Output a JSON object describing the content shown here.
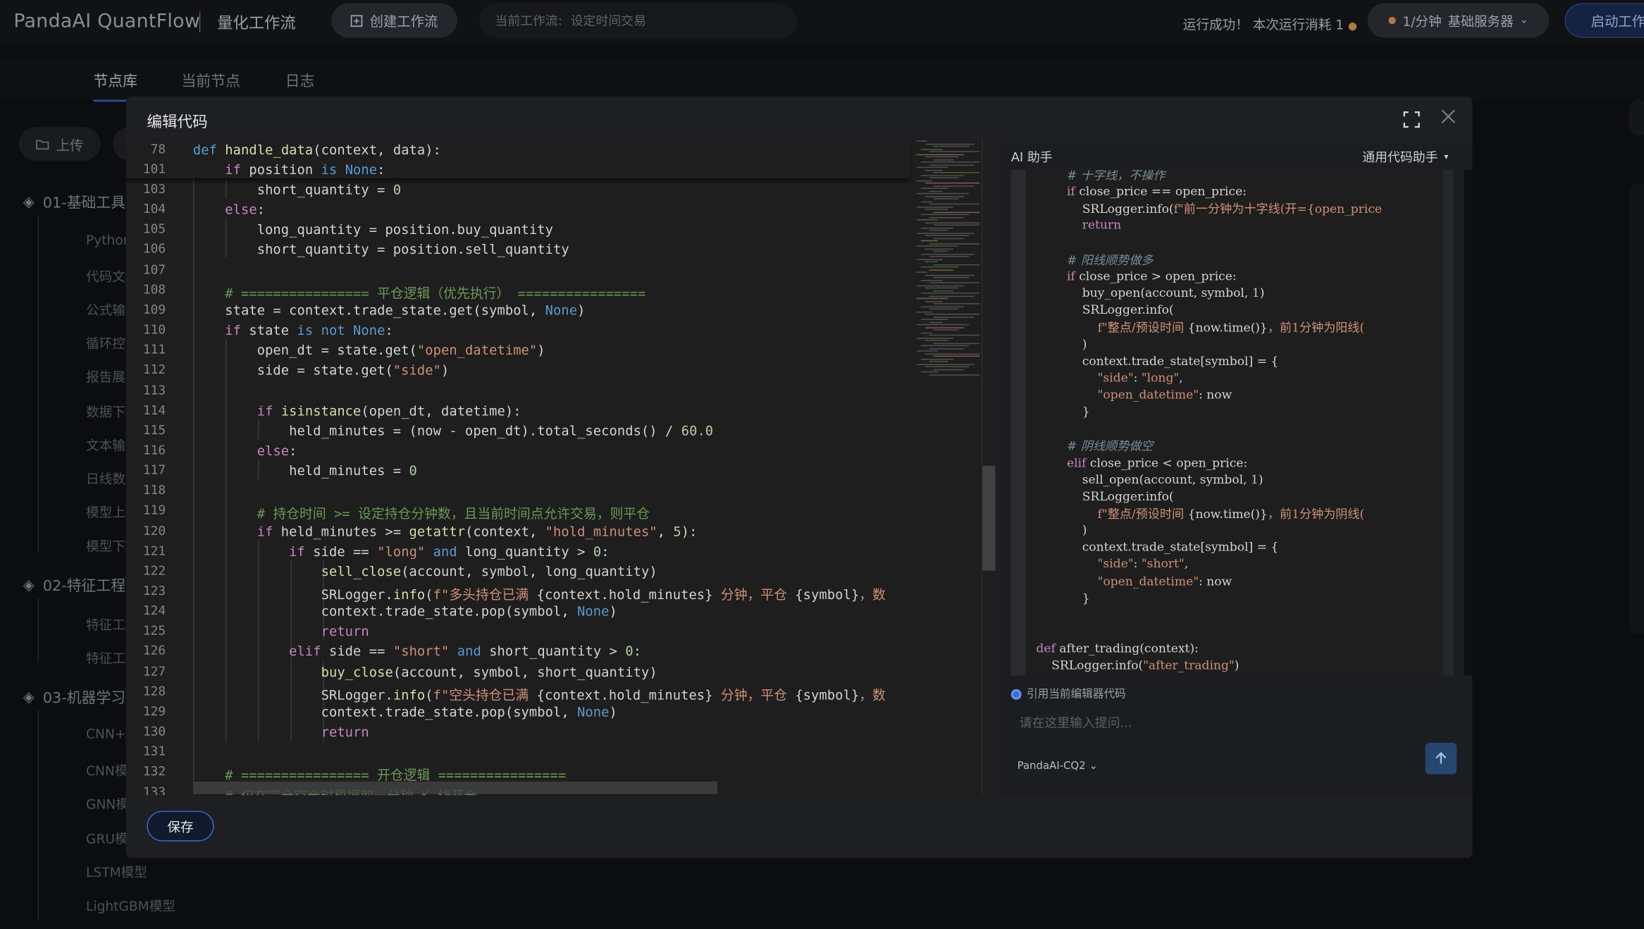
{
  "topbar": {
    "logo": "PandaAI QuantFlow",
    "subtitle": "量化工作流",
    "create_button": "创建工作流",
    "flow_label": "当前工作流:",
    "flow_name": "设定时间交易",
    "run_status": "运行成功！ 本次运行消耗 1",
    "server_rate": "1/分钟",
    "server_name": "基础服务器",
    "start_button": "启动工作"
  },
  "left_panel": {
    "tabs": [
      "节点库",
      "当前节点",
      "日志"
    ],
    "upload_button": "上传",
    "categories": [
      "01-基础工具",
      "02-特征工程",
      "03-机器学习"
    ],
    "items_group1": [
      "Python",
      "代码文",
      "公式输",
      "循环控",
      "报告展",
      "数据下",
      "文本输",
      "日线数",
      "模型上",
      "模型下"
    ],
    "items_group2": [
      "特征工",
      "特征工"
    ],
    "items_group3": [
      "CNN+T",
      "CNN模",
      "GNN模",
      "GRU模",
      "LSTM模型",
      "LightGBM模型"
    ]
  },
  "modal": {
    "title": "编辑代码",
    "save_button": "保存"
  },
  "editor": {
    "sticky": [
      {
        "n": "78",
        "html": "<span class=\"kw\">def</span> <span class=\"fn\">handle_data</span>(context, data):"
      },
      {
        "n": "101",
        "html": "    <span class=\"kw2\">if</span> position <span class=\"kw\">is</span> <span class=\"kw\">None</span>:"
      }
    ],
    "lines": [
      {
        "n": "103",
        "html": "        short_quantity = <span class=\"nm\">0</span>"
      },
      {
        "n": "104",
        "html": "    <span class=\"kw2\">else</span>:"
      },
      {
        "n": "105",
        "html": "        long_quantity = position.buy_quantity"
      },
      {
        "n": "106",
        "html": "        short_quantity = position.sell_quantity"
      },
      {
        "n": "107",
        "html": ""
      },
      {
        "n": "108",
        "html": "    <span class=\"cm\"># ================ 平仓逻辑（优先执行） ================</span>"
      },
      {
        "n": "109",
        "html": "    state = context.trade_state.get(symbol, <span class=\"kw\">None</span>)"
      },
      {
        "n": "110",
        "html": "    <span class=\"kw2\">if</span> state <span class=\"kw\">is not</span> <span class=\"kw\">None</span>:"
      },
      {
        "n": "111",
        "html": "        open_dt = state.get(<span class=\"st\">\"open_datetime\"</span>)"
      },
      {
        "n": "112",
        "html": "        side = state.get(<span class=\"st\">\"side\"</span>)"
      },
      {
        "n": "113",
        "html": ""
      },
      {
        "n": "114",
        "html": "        <span class=\"kw2\">if</span> <span class=\"fn\">isinstance</span>(open_dt, datetime):"
      },
      {
        "n": "115",
        "html": "            held_minutes = (now - open_dt).total_seconds() / <span class=\"nm\">60.0</span>"
      },
      {
        "n": "116",
        "html": "        <span class=\"kw2\">else</span>:"
      },
      {
        "n": "117",
        "html": "            held_minutes = <span class=\"nm\">0</span>"
      },
      {
        "n": "118",
        "html": ""
      },
      {
        "n": "119",
        "html": "        <span class=\"cm\"># 持仓时间 >= 设定持仓分钟数，且当前时间点允许交易，则平仓</span>"
      },
      {
        "n": "120",
        "html": "        <span class=\"kw2\">if</span> held_minutes >= <span class=\"fn\">getattr</span>(context, <span class=\"st\">\"hold_minutes\"</span>, <span class=\"nm\">5</span>):"
      },
      {
        "n": "121",
        "html": "            <span class=\"kw2\">if</span> side == <span class=\"st\">\"long\"</span> <span class=\"kw\">and</span> long_quantity > <span class=\"nm\">0</span>:"
      },
      {
        "n": "122",
        "html": "                <span class=\"fn\">sell_close</span>(account, symbol, long_quantity)"
      },
      {
        "n": "123",
        "html": "                SRLogger.<span class=\"fn\">info</span>(<span class=\"st\">f\"多头持仓已满 </span>{context.hold_minutes}<span class=\"st\"> 分钟，平仓 </span>{symbol}<span class=\"st\">，数</span>"
      },
      {
        "n": "124",
        "html": "                context.trade_state.pop(symbol, <span class=\"kw\">None</span>)"
      },
      {
        "n": "125",
        "html": "                <span class=\"kw2\">return</span>"
      },
      {
        "n": "126",
        "html": "            <span class=\"kw2\">elif</span> side == <span class=\"st\">\"short\"</span> <span class=\"kw\">and</span> short_quantity > <span class=\"nm\">0</span>:"
      },
      {
        "n": "127",
        "html": "                <span class=\"fn\">buy_close</span>(account, symbol, short_quantity)"
      },
      {
        "n": "128",
        "html": "                SRLogger.<span class=\"fn\">info</span>(<span class=\"st\">f\"空头持仓已满 </span>{context.hold_minutes}<span class=\"st\"> 分钟，平仓 </span>{symbol}<span class=\"st\">，数</span>"
      },
      {
        "n": "129",
        "html": "                context.trade_state.pop(symbol, <span class=\"kw\">None</span>)"
      },
      {
        "n": "130",
        "html": "                <span class=\"kw2\">return</span>"
      },
      {
        "n": "131",
        "html": ""
      },
      {
        "n": "132",
        "html": "    <span class=\"cm\"># ================ 开仓逻辑 ================</span>"
      },
      {
        "n": "133",
        "html": "    <span class=\"cm\"># 仅在完全空仓时根据前一分钟 K 线开仓</span>"
      }
    ]
  },
  "ai": {
    "title": "AI 助手",
    "mode": "通用代码助手",
    "code": [
      {
        "html": "        <span class=\"cm\" style=\"font-style:italic;color:#7a8a9a\"># 十字线，不操作</span>"
      },
      {
        "html": "        <span class=\"kw\" style=\"color:#c586c0\">if</span> close_price == open_price:"
      },
      {
        "html": "            SRLogger.info(<span class=\"st\">f\"前一分钟为十字线(开={open_price</span>"
      },
      {
        "html": "            <span class=\"kw2\">return</span>"
      },
      {
        "html": ""
      },
      {
        "html": "        <span style=\"font-style:italic;color:#7a8a9a\"># 阳线顺势做多</span>"
      },
      {
        "html": "        <span class=\"kw2\">if</span> close_price > open_price:"
      },
      {
        "html": "            buy_open(account, symbol, <span class=\"nm\">1</span>)"
      },
      {
        "html": "            SRLogger.info("
      },
      {
        "html": "                <span class=\"st\">f\"整点/预设时间 </span>{now.time()}<span class=\"st\">，前1分钟为阳线(</span>"
      },
      {
        "html": "            )"
      },
      {
        "html": "            context.trade_state[symbol] = {"
      },
      {
        "html": "                <span class=\"st\">\"side\"</span>: <span class=\"st\">\"long\"</span>,"
      },
      {
        "html": "                <span class=\"st\">\"open_datetime\"</span>: now"
      },
      {
        "html": "            }"
      },
      {
        "html": ""
      },
      {
        "html": "        <span style=\"font-style:italic;color:#7a8a9a\"># 阴线顺势做空</span>"
      },
      {
        "html": "        <span class=\"kw2\">elif</span> close_price < open_price:"
      },
      {
        "html": "            sell_open(account, symbol, <span class=\"nm\">1</span>)"
      },
      {
        "html": "            SRLogger.info("
      },
      {
        "html": "                <span class=\"st\">f\"整点/预设时间 </span>{now.time()}<span class=\"st\">，前1分钟为阴线(</span>"
      },
      {
        "html": "            )"
      },
      {
        "html": "            context.trade_state[symbol] = {"
      },
      {
        "html": "                <span class=\"st\">\"side\"</span>: <span class=\"st\">\"short\"</span>,"
      },
      {
        "html": "                <span class=\"st\">\"open_datetime\"</span>: now"
      },
      {
        "html": "            }"
      },
      {
        "html": ""
      },
      {
        "html": ""
      },
      {
        "html": "<span class=\"kw2\">def</span> after_trading(context):"
      },
      {
        "html": "    SRLogger.info(<span class=\"st\">\"after_trading\"</span>)"
      }
    ],
    "reference_label": "引用当前编辑器代码",
    "input_placeholder": "请在这里输入提问...",
    "model": "PandaAI-CQ2"
  }
}
